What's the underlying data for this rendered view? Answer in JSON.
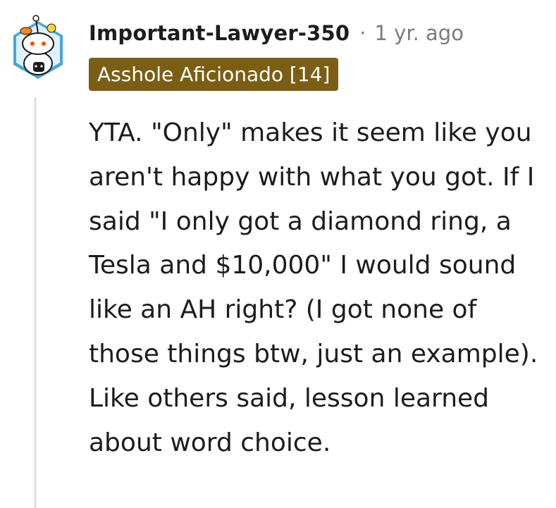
{
  "comment": {
    "author": "Important-Lawyer-350",
    "separator": "·",
    "timestamp": "1 yr. ago",
    "flair": "Asshole Aficionado [14]",
    "body": "YTA. \"Only\" makes it seem like you aren't happy with what you got. If I said \"I only got a diamond ring, a Tesla and $10,000\" I would sound like an AH right? (I got none of those things btw, just an example). Like others said, lesson learned about word choice."
  },
  "colors": {
    "flair_background": "#7b5e14",
    "flair_text": "#ffffff",
    "meta_text": "#7c7c7c",
    "thread_line": "#e6e6e6",
    "avatar_hex": "#4aa6d8"
  },
  "icons": {
    "avatar": "snoo-avatar-icon"
  }
}
